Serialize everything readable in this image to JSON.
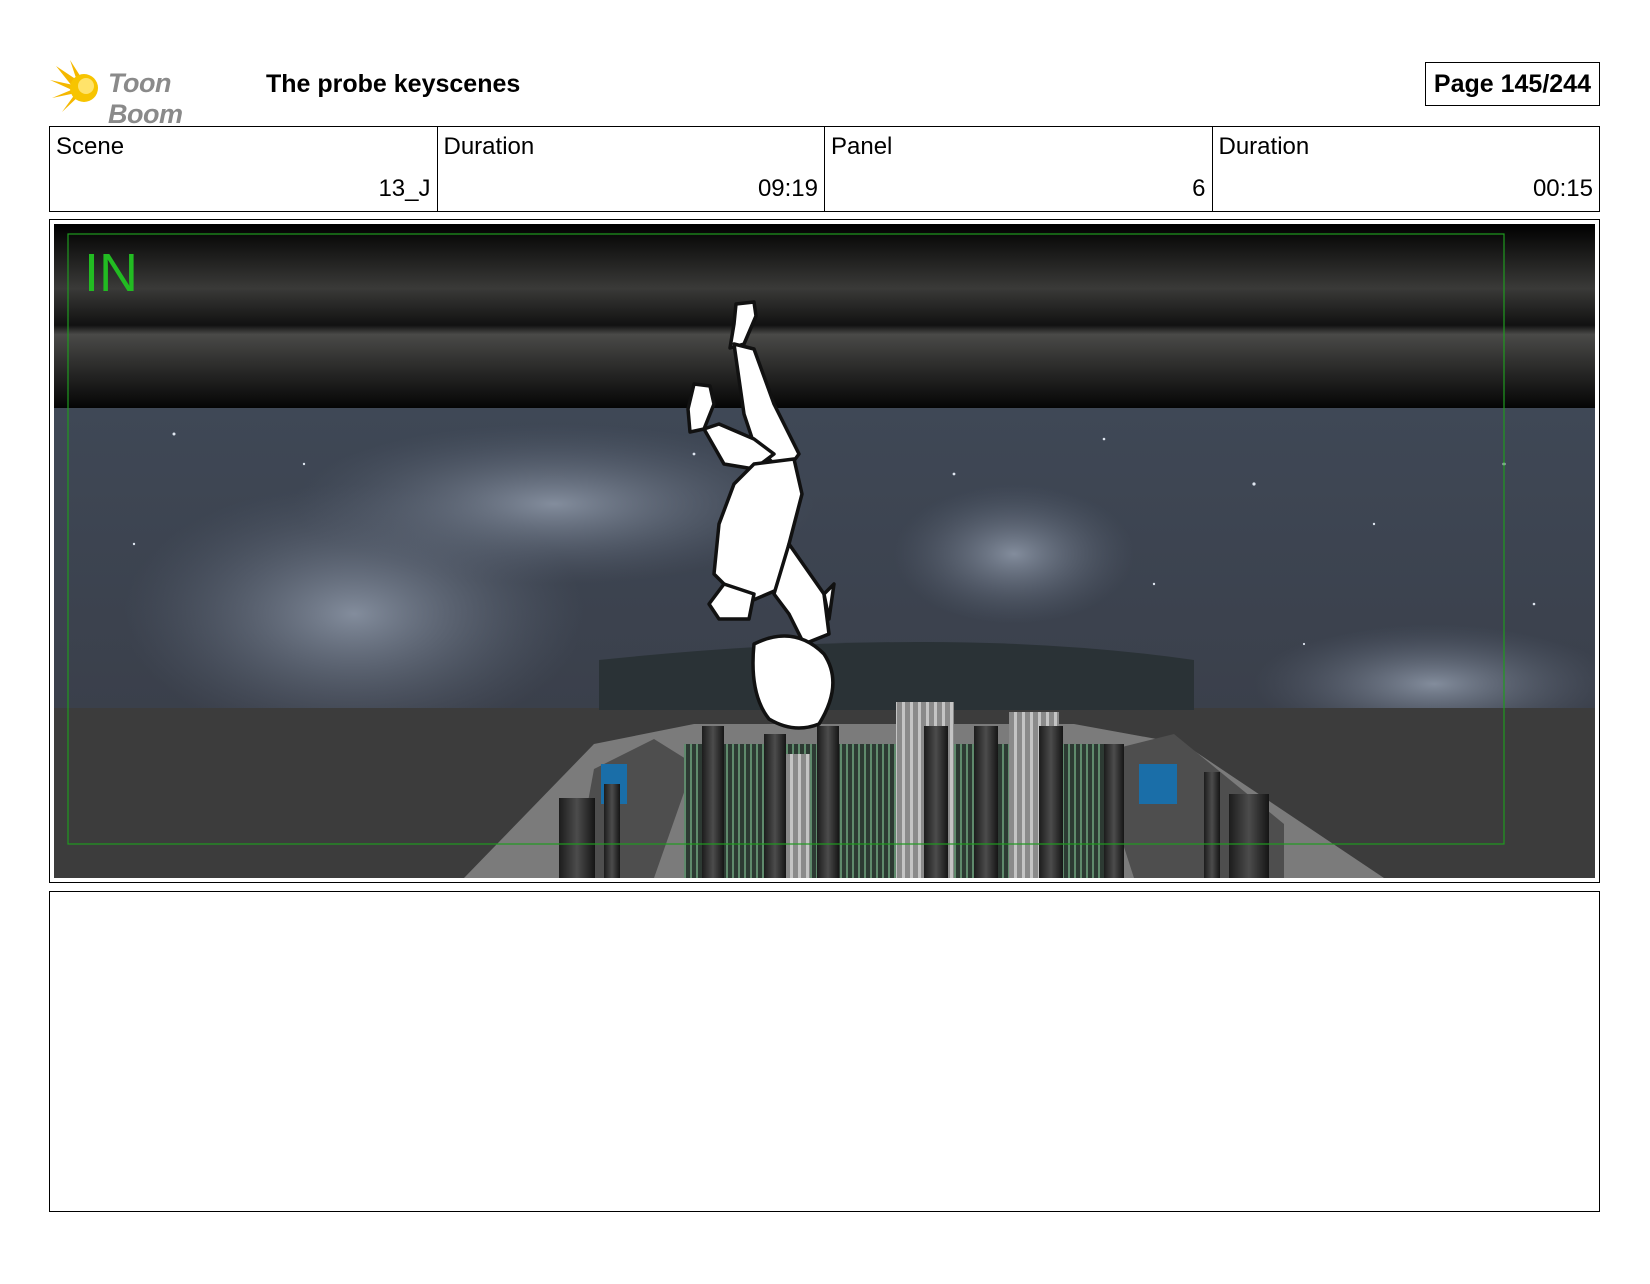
{
  "header": {
    "logo_text": "Toon Boom",
    "project_title": "The probe keyscenes",
    "page_label": "Page 145/244"
  },
  "info": {
    "scene_label": "Scene",
    "scene_value": "13_J",
    "scene_duration_label": "Duration",
    "scene_duration_value": "09:19",
    "panel_label": "Panel",
    "panel_value": "6",
    "panel_duration_label": "Duration",
    "panel_duration_value": "00:15"
  },
  "panel": {
    "overlay_label": "IN",
    "overlay_color": "#22bb22"
  },
  "notes": {
    "text": ""
  }
}
